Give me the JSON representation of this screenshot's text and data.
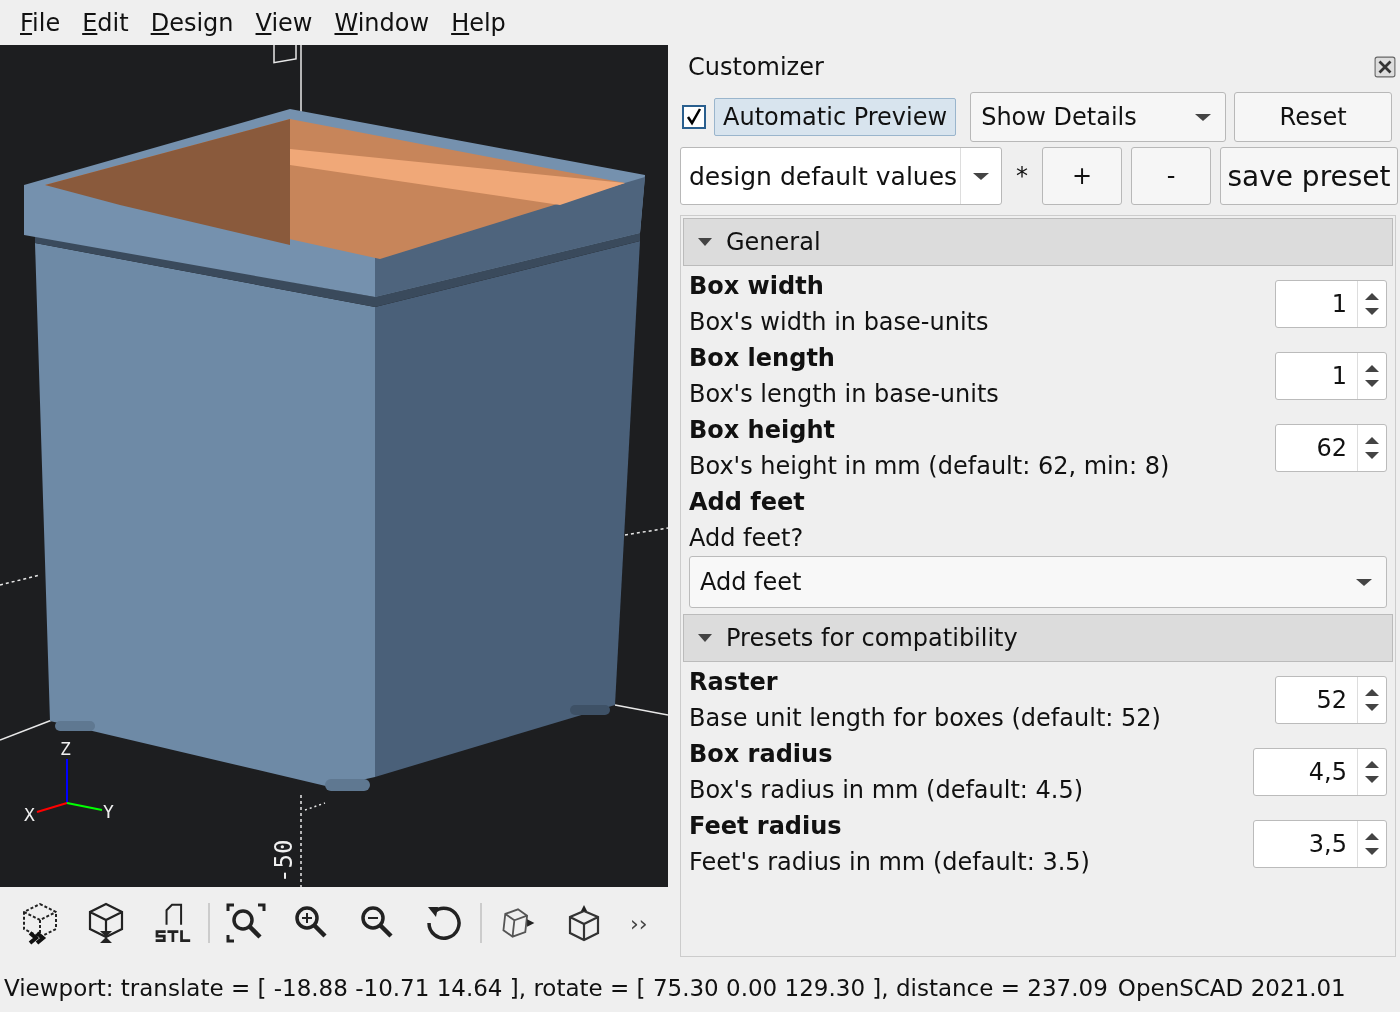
{
  "menu": [
    "File",
    "Edit",
    "Design",
    "View",
    "Window",
    "Help"
  ],
  "viewport": {
    "axis_labels": {
      "z": "Z",
      "x": "X",
      "y": "Y"
    },
    "scale_label": "-50"
  },
  "toolbar": {
    "more": "››"
  },
  "customizer": {
    "title": "Customizer",
    "automatic_preview": {
      "label": "Automatic Preview",
      "checked": true
    },
    "details_dropdown": "Show Details",
    "reset": "Reset",
    "preset": {
      "value": "design default values",
      "modified_mark": "*",
      "add": "+",
      "remove": "-",
      "save": "save preset"
    },
    "groups": [
      {
        "title": "General",
        "expanded": true,
        "params": [
          {
            "kind": "spin",
            "name": "Box width",
            "description": "Box's width in base-units",
            "value": "1"
          },
          {
            "kind": "spin",
            "name": "Box length",
            "description": "Box's length in base-units",
            "value": "1"
          },
          {
            "kind": "spin",
            "name": "Box height",
            "description": "Box's height in mm (default: 62, min: 8)",
            "value": "62"
          },
          {
            "kind": "dropdown",
            "name": "Add feet",
            "description": "Add feet?",
            "value": "Add feet"
          }
        ]
      },
      {
        "title": "Presets for compatibility",
        "expanded": true,
        "params": [
          {
            "kind": "spin",
            "name": "Raster",
            "description": "Base unit length for boxes (default: 52)",
            "value": "52"
          },
          {
            "kind": "spin",
            "name": "Box radius",
            "description": "Box's radius in mm (default: 4.5)",
            "value": "4,5",
            "wide": true
          },
          {
            "kind": "spin",
            "name": "Feet radius",
            "description": "Feet's radius in mm (default: 3.5)",
            "value": "3,5",
            "wide": true
          }
        ]
      }
    ]
  },
  "status_bar": {
    "viewport": "Viewport: translate = [ -18.88 -10.71 14.64 ], rotate = [ 75.30 0.00 129.30 ], distance = 237.09",
    "version": "OpenSCAD 2021.01"
  }
}
